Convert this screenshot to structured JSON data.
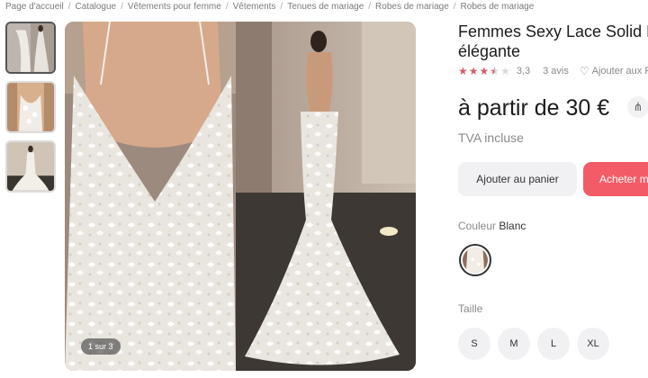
{
  "breadcrumb": [
    "Page d'accueil",
    "Catalogue",
    "Vêtements pour femme",
    "Vêtements",
    "Tenues de mariage",
    "Robes de mariage",
    "Robes de mariage"
  ],
  "product": {
    "title_line1": "Femmes Sexy Lace Solid H",
    "title_line2": "élégante",
    "rating_value": "3,3",
    "rating_stars": 3.3,
    "reviews": "3 avis",
    "favorite_label": "Ajouter aux F",
    "price": "à partir de 30 €",
    "tax_note": "TVA incluse"
  },
  "gallery": {
    "counter": "1 sur 3"
  },
  "actions": {
    "add_to_cart": "Ajouter au panier",
    "buy": "Acheter m"
  },
  "color": {
    "label": "Couleur",
    "value": "Blanc"
  },
  "size": {
    "label": "Taille",
    "options": [
      "S",
      "M",
      "L",
      "XL"
    ]
  },
  "colors": {
    "accent": "#f35c66",
    "star": "#d65a6a"
  }
}
